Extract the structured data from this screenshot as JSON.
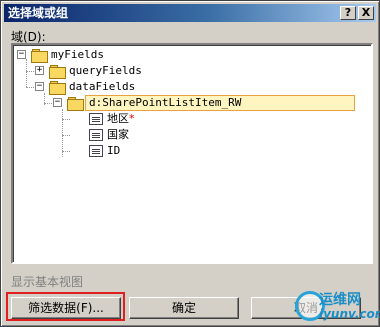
{
  "window": {
    "title": "选择域或组",
    "help_button": "?",
    "close_button": "X"
  },
  "domain_label": "域(D):",
  "tree": {
    "nodes": [
      {
        "label": "myFields",
        "expander": "−"
      },
      {
        "label": "queryFields",
        "expander": "+"
      },
      {
        "label": "dataFields",
        "expander": "−"
      },
      {
        "label": "d:SharePointListItem_RW",
        "expander": "−"
      },
      {
        "label": "地区",
        "required_marker": "*"
      },
      {
        "label": "国家"
      },
      {
        "label": "ID"
      }
    ]
  },
  "show_basic_view": "显示基本视图",
  "buttons": {
    "filter": "筛选数据(F)...",
    "ok": "确定",
    "cancel": "取消"
  },
  "watermark": {
    "line1": "运维网",
    "line2": "iyunv.com"
  },
  "colors": {
    "title_bar": "#0a246a",
    "dialog_bg": "#d4d0c8",
    "highlight": "#e02020",
    "selection_border": "#e8a040"
  }
}
